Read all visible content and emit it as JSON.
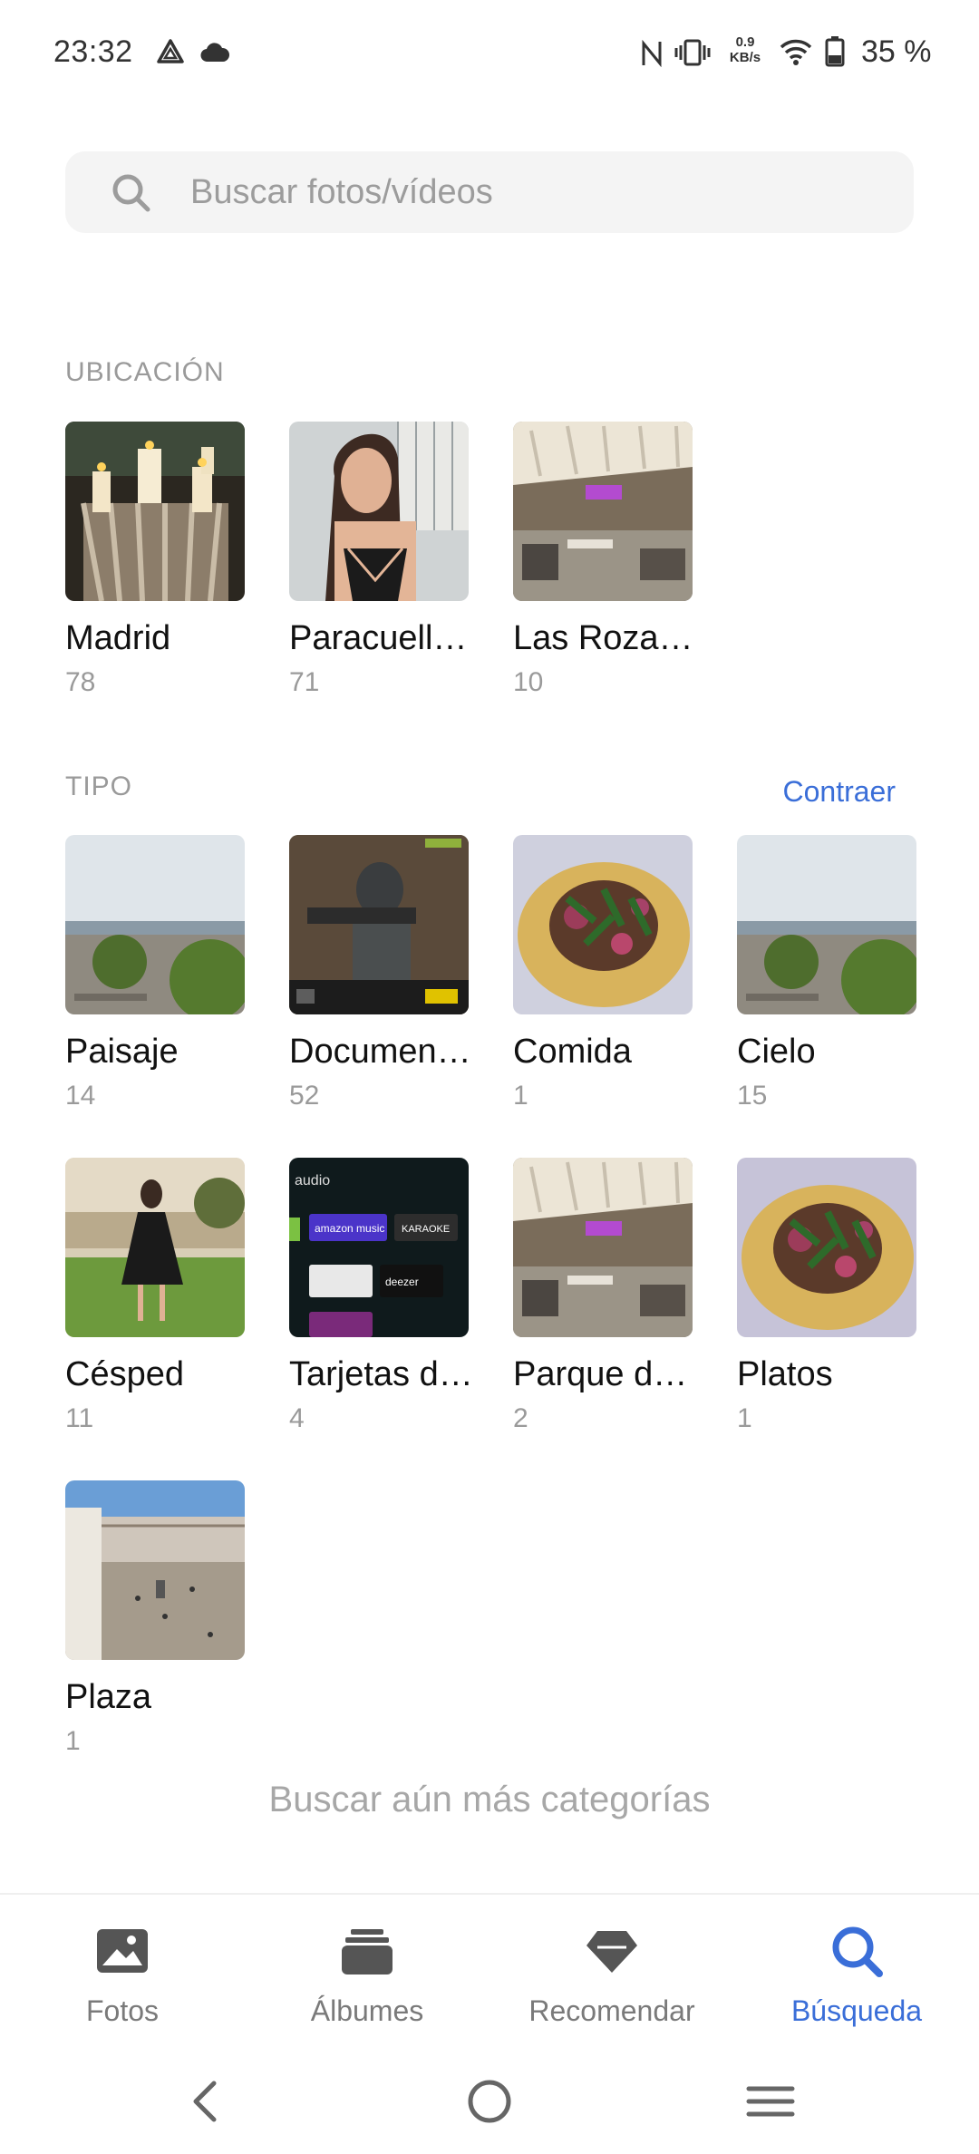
{
  "status_bar": {
    "time": "23:32",
    "net_speed_value": "0.9",
    "net_speed_unit": "KB/s",
    "battery": "35 %",
    "icons": [
      "drive-icon",
      "cloud-icon",
      "nfc-icon",
      "vibrate-icon",
      "wifi-icon",
      "battery-icon"
    ]
  },
  "search": {
    "placeholder": "Buscar fotos/vídeos"
  },
  "sections": {
    "location": {
      "title": "UBICACIÓN",
      "items": [
        {
          "label": "Madrid",
          "count": "78",
          "thumb": "candles"
        },
        {
          "label": "Paracuell…",
          "count": "71",
          "thumb": "portrait"
        },
        {
          "label": "Las Roza…",
          "count": "10",
          "thumb": "terrace"
        }
      ]
    },
    "type": {
      "title": "TIPO",
      "collapse_label": "Contraer",
      "items": [
        {
          "label": "Paisaje",
          "count": "14",
          "thumb": "landscape"
        },
        {
          "label": "Documen…",
          "count": "52",
          "thumb": "soldier"
        },
        {
          "label": "Comida",
          "count": "1",
          "thumb": "taco"
        },
        {
          "label": "Cielo",
          "count": "15",
          "thumb": "landscape"
        },
        {
          "label": "Césped",
          "count": "11",
          "thumb": "lawn"
        },
        {
          "label": "Tarjetas d…",
          "count": "4",
          "thumb": "apps"
        },
        {
          "label": "Parque d…",
          "count": "2",
          "thumb": "terrace"
        },
        {
          "label": "Platos",
          "count": "1",
          "thumb": "taco"
        },
        {
          "label": "Plaza",
          "count": "1",
          "thumb": "plaza"
        }
      ]
    }
  },
  "more_categories": "Buscar aún más categorías",
  "thumb_text": {
    "audio": "audio",
    "amazon": "amazon music",
    "karaoke": "KARAOKE",
    "deezer": "deezer"
  },
  "bottom_nav": [
    {
      "label": "Fotos",
      "icon": "photo-icon",
      "active": false
    },
    {
      "label": "Álbumes",
      "icon": "albums-icon",
      "active": false
    },
    {
      "label": "Recomendar",
      "icon": "diamond-icon",
      "active": false
    },
    {
      "label": "Búsqueda",
      "icon": "search-icon",
      "active": true
    }
  ],
  "colors": {
    "accent": "#3a6ed8",
    "muted": "#9a9a9a"
  }
}
